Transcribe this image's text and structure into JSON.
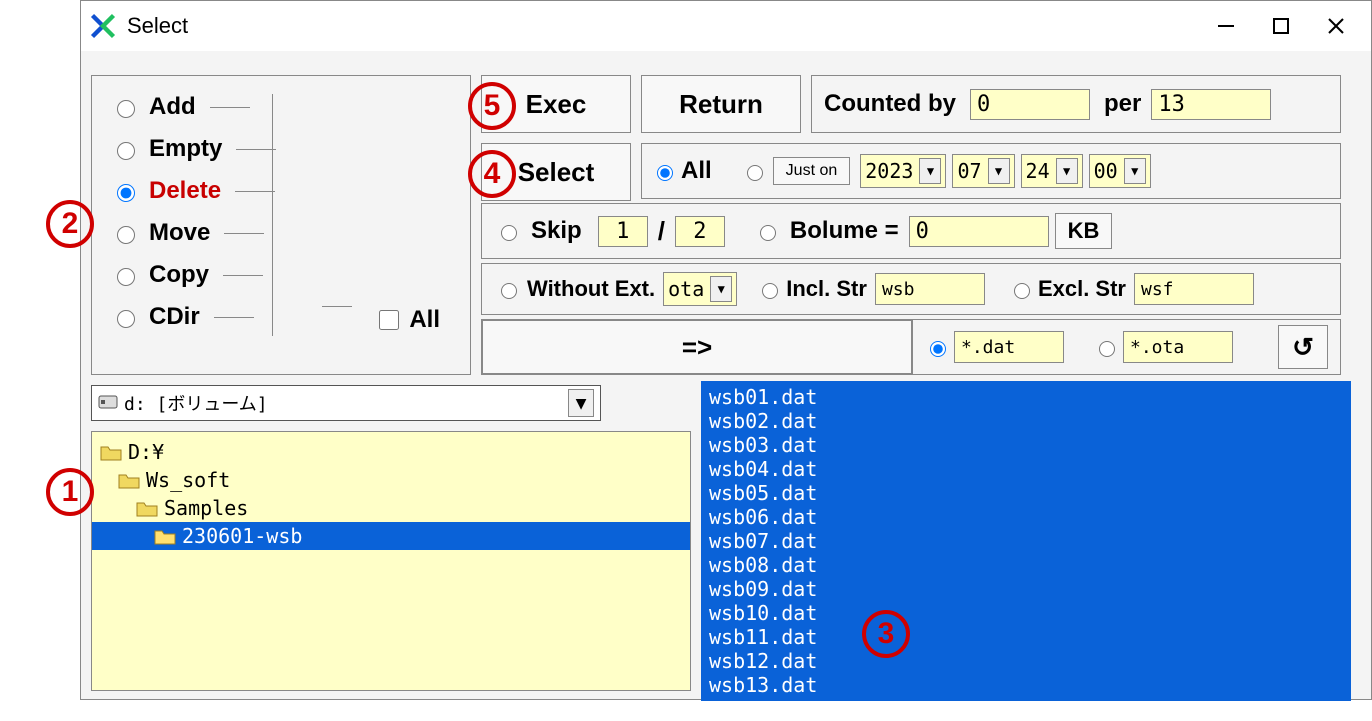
{
  "title": "Select",
  "actions": {
    "items": [
      "Add",
      "Empty",
      "Delete",
      "Move",
      "Copy",
      "CDir"
    ],
    "selected": "Delete",
    "all_label": "All",
    "all_checked": false
  },
  "buttons": {
    "exec": "Exec",
    "return": "Return",
    "select": "Select",
    "arrow": "=>"
  },
  "counted": {
    "label": "Counted by",
    "value": "0",
    "per_label": "per",
    "per_value": "13"
  },
  "filters": {
    "all_label": "All",
    "just_on_label": "Just on",
    "date": {
      "year": "2023",
      "month": "07",
      "day": "24",
      "hour": "00"
    },
    "skip_label": "Skip",
    "skip_a": "1",
    "skip_b": "2",
    "volume_label": "Bolume =",
    "volume_value": "0",
    "volume_unit": "KB",
    "without_ext_label": "Without Ext.",
    "without_ext_value": "ota",
    "incl_label": "Incl. Str",
    "incl_value": "wsb",
    "excl_label": "Excl. Str",
    "excl_value": "wsf",
    "pattern1": "*.dat",
    "pattern2": "*.ota",
    "pattern_selected": "*.dat",
    "reload": "↻"
  },
  "drive": {
    "label": "d: [ボリューム]"
  },
  "tree": [
    {
      "label": "D:¥",
      "indent": 0,
      "selected": false
    },
    {
      "label": "Ws_soft",
      "indent": 1,
      "selected": false
    },
    {
      "label": "Samples",
      "indent": 2,
      "selected": false
    },
    {
      "label": "230601-wsb",
      "indent": 3,
      "selected": true
    }
  ],
  "files": [
    "wsb01.dat",
    "wsb02.dat",
    "wsb03.dat",
    "wsb04.dat",
    "wsb05.dat",
    "wsb06.dat",
    "wsb07.dat",
    "wsb08.dat",
    "wsb09.dat",
    "wsb10.dat",
    "wsb11.dat",
    "wsb12.dat",
    "wsb13.dat"
  ],
  "annotations": {
    "a1": "1",
    "a2": "2",
    "a3": "3",
    "a4": "4",
    "a5": "5"
  }
}
